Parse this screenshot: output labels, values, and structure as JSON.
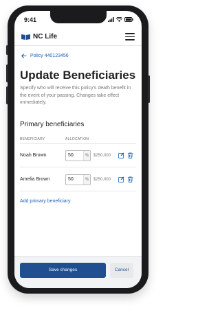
{
  "status_bar": {
    "time": "9:41",
    "icons": [
      "signal-icon",
      "wifi-icon",
      "battery-icon"
    ]
  },
  "header": {
    "brand": "NC Life",
    "logo_icon": "book-icon",
    "menu_icon": "hamburger-menu-icon"
  },
  "breadcrumb": {
    "label": "Policy 440123456",
    "icon": "arrow-left-icon"
  },
  "page": {
    "title": "Update Beneficiaries",
    "description": "Specify who will receive this policy's death benefit in the event of your passing. Changes take effect immediately."
  },
  "beneficiaries": {
    "section_title": "Primary beneficiaries",
    "columns": {
      "beneficiary": "BENEFICIARY",
      "allocation": "ALLOCATION"
    },
    "unit": "%",
    "rows": [
      {
        "name": "Noah Brown",
        "allocation": "50",
        "amount": "$250,000"
      },
      {
        "name": "Amelia Brown",
        "allocation": "50",
        "amount": "$250,000"
      }
    ],
    "add_label": "Add primary beneficiary"
  },
  "footer": {
    "save_label": "Save changes",
    "cancel_label": "Cancel"
  },
  "colors": {
    "primary": "#1f4f91",
    "link": "#1f5fb6",
    "text": "#222222",
    "muted": "#777777"
  }
}
